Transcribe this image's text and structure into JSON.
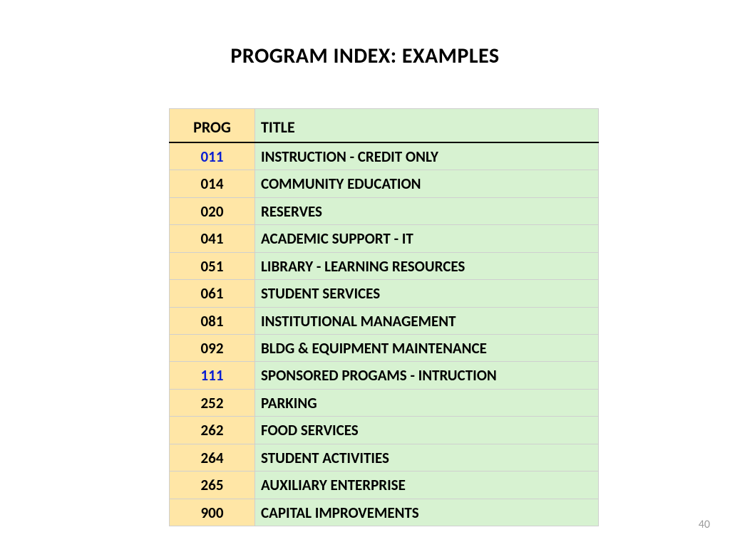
{
  "slide": {
    "title": "PROGRAM INDEX: EXAMPLES",
    "page_number": "40"
  },
  "table": {
    "headers": {
      "prog": "PROG",
      "title": "TITLE"
    },
    "rows": [
      {
        "prog": "011",
        "title": "INSTRUCTION  - CREDIT ONLY",
        "highlight": true
      },
      {
        "prog": "014",
        "title": "COMMUNITY EDUCATION",
        "highlight": false
      },
      {
        "prog": "020",
        "title": "RESERVES",
        "highlight": false
      },
      {
        "prog": "041",
        "title": "ACADEMIC SUPPORT - IT",
        "highlight": false
      },
      {
        "prog": "051",
        "title": "LIBRARY - LEARNING RESOURCES",
        "highlight": false
      },
      {
        "prog": "061",
        "title": "STUDENT SERVICES",
        "highlight": false
      },
      {
        "prog": "081",
        "title": "INSTITUTIONAL MANAGEMENT",
        "highlight": false
      },
      {
        "prog": "092",
        "title": "BLDG & EQUIPMENT MAINTENANCE",
        "highlight": false
      },
      {
        "prog": "111",
        "title": "SPONSORED PROGAMS - INTRUCTION",
        "highlight": true
      },
      {
        "prog": "252",
        "title": "PARKING",
        "highlight": false
      },
      {
        "prog": "262",
        "title": "FOOD SERVICES",
        "highlight": false
      },
      {
        "prog": "264",
        "title": "STUDENT ACTIVITIES",
        "highlight": false
      },
      {
        "prog": "265",
        "title": "AUXILIARY ENTERPRISE",
        "highlight": false
      },
      {
        "prog": "900",
        "title": "CAPITAL IMPROVEMENTS",
        "highlight": false
      }
    ]
  }
}
